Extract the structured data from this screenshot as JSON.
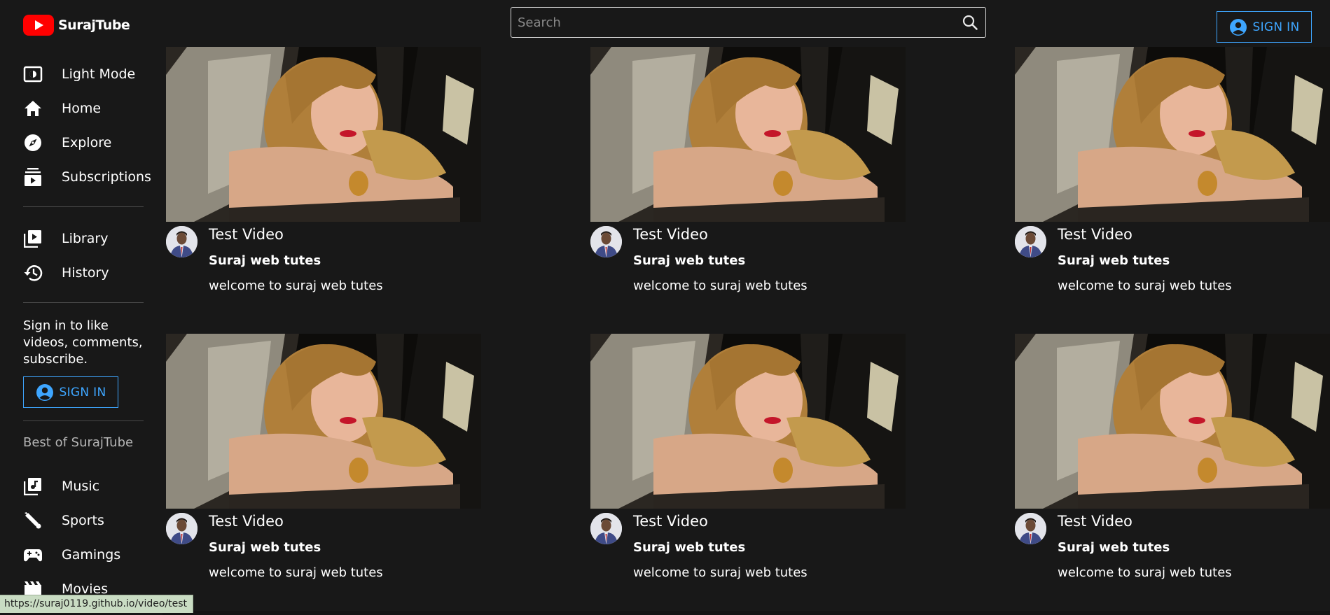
{
  "header": {
    "app_name": "SurajTube",
    "search_placeholder": "Search",
    "signin_label": "SIGN IN"
  },
  "sidebar": {
    "primary": [
      {
        "label": "Light Mode",
        "icon": "light-mode-icon"
      },
      {
        "label": "Home",
        "icon": "home-icon"
      },
      {
        "label": "Explore",
        "icon": "explore-icon"
      },
      {
        "label": "Subscriptions",
        "icon": "subscriptions-icon"
      }
    ],
    "secondary": [
      {
        "label": "Library",
        "icon": "library-icon"
      },
      {
        "label": "History",
        "icon": "history-icon"
      }
    ],
    "signin_prompt": "Sign in to like videos, comments, subscribe.",
    "signin_label": "SIGN IN",
    "best_of_title": "Best of SurajTube",
    "best_of": [
      {
        "label": "Music",
        "icon": "music-icon"
      },
      {
        "label": "Sports",
        "icon": "sports-icon"
      },
      {
        "label": "Gamings",
        "icon": "gaming-icon"
      },
      {
        "label": "Movies",
        "icon": "movies-icon"
      }
    ]
  },
  "videos": [
    {
      "title": "Test Video",
      "channel": "Suraj web tutes",
      "description": "welcome to suraj web tutes"
    },
    {
      "title": "Test Video",
      "channel": "Suraj web tutes",
      "description": "welcome to suraj web tutes"
    },
    {
      "title": "Test Video",
      "channel": "Suraj web tutes",
      "description": "welcome to suraj web tutes"
    },
    {
      "title": "Test Video",
      "channel": "Suraj web tutes",
      "description": "welcome to suraj web tutes"
    },
    {
      "title": "Test Video",
      "channel": "Suraj web tutes",
      "description": "welcome to suraj web tutes"
    },
    {
      "title": "Test Video",
      "channel": "Suraj web tutes",
      "description": "welcome to suraj web tutes"
    }
  ],
  "status_url": "https://suraj0119.github.io/video/test",
  "colors": {
    "background": "#181818",
    "accent": "#3ea6ff",
    "logo_red": "#ff0000"
  }
}
